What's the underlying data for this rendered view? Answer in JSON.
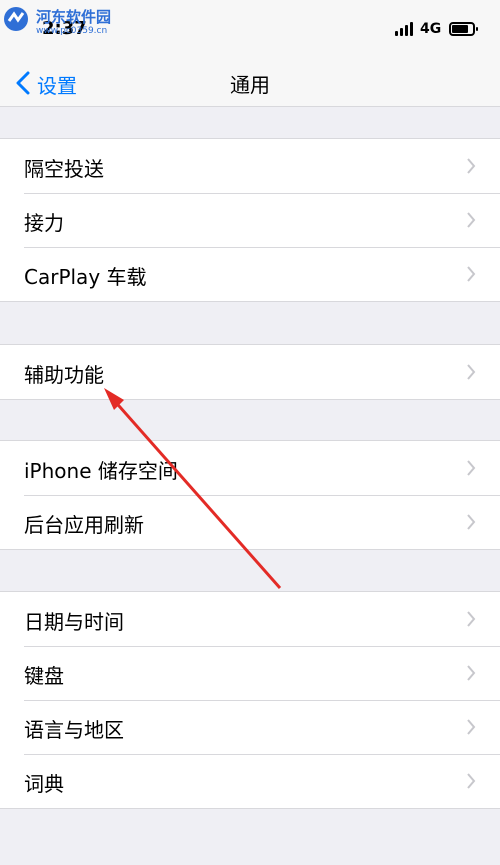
{
  "watermark": {
    "name": "河东软件园",
    "url": "www.pc0359.cn"
  },
  "status_bar": {
    "time": "2:37",
    "network": "4G"
  },
  "nav": {
    "back_label": "设置",
    "title": "通用"
  },
  "groups": [
    {
      "items": [
        "隔空投送",
        "接力",
        "CarPlay 车载"
      ]
    },
    {
      "items": [
        "辅助功能"
      ]
    },
    {
      "items": [
        "iPhone 储存空间",
        "后台应用刷新"
      ]
    },
    {
      "items": [
        "日期与时间",
        "键盘",
        "语言与地区",
        "词典"
      ]
    }
  ],
  "colors": {
    "accent": "#007aff",
    "annotation_arrow": "#e32b26",
    "background": "#efeff4"
  },
  "icons": {
    "back": "chevron-left-icon",
    "row": "chevron-right-icon"
  }
}
